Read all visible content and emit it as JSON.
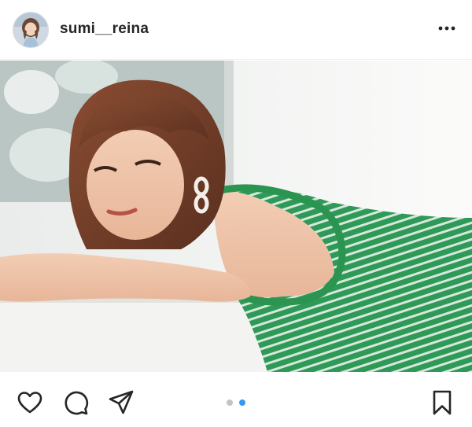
{
  "header": {
    "username": "sumi__reina",
    "avatar_icon": "profile-avatar",
    "more_icon": "more-options-icon"
  },
  "post": {
    "photo_icon": "post-photo",
    "carousel": {
      "total": 2,
      "current": 2,
      "active_color": "#3897f0",
      "inactive_color": "#c4c4c4"
    }
  },
  "actions": {
    "like_icon": "heart-icon",
    "comment_icon": "comment-icon",
    "share_icon": "paper-plane-icon",
    "save_icon": "bookmark-icon"
  }
}
